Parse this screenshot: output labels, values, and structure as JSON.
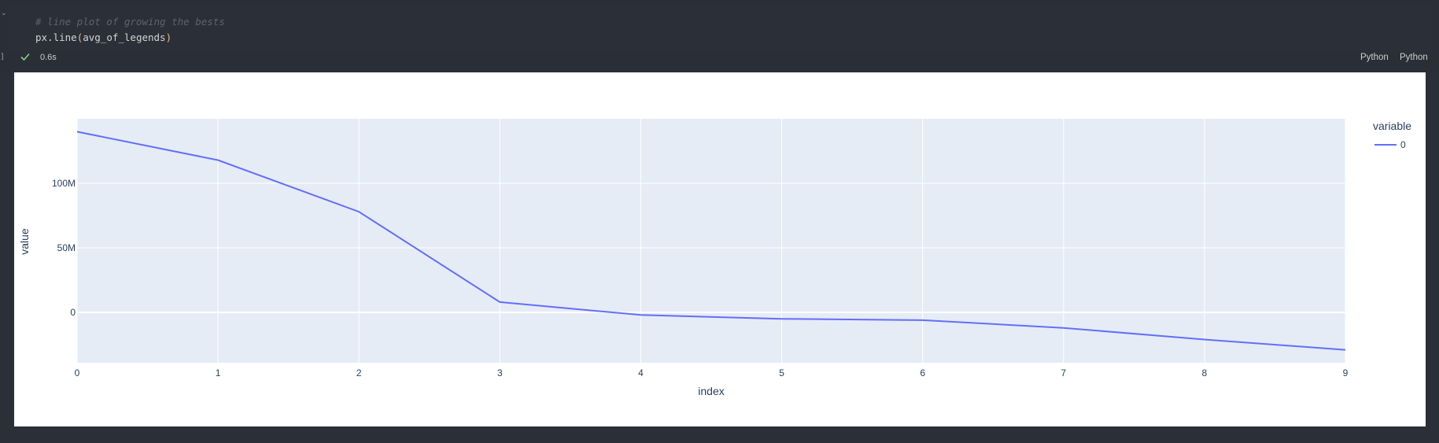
{
  "cell": {
    "code_comment": "# line plot of growing the bests",
    "code_fn": "px.line",
    "code_open": "(",
    "code_arg": "avg_of_legends",
    "code_close": ")",
    "exec_time": "0.6s",
    "lang_labels": [
      "Python",
      "Python"
    ]
  },
  "chart_data": {
    "type": "line",
    "title": "",
    "xlabel": "index",
    "ylabel": "value",
    "x": [
      0,
      1,
      2,
      3,
      4,
      5,
      6,
      7,
      8,
      9
    ],
    "x_ticks": [
      "0",
      "1",
      "2",
      "3",
      "4",
      "5",
      "6",
      "7",
      "8",
      "9"
    ],
    "y_ticks": [
      {
        "value": 0,
        "label": "0"
      },
      {
        "value": 50000000,
        "label": "50M"
      },
      {
        "value": 100000000,
        "label": "100M"
      }
    ],
    "xlim": [
      0,
      9
    ],
    "ylim": [
      -39000000,
      150000000
    ],
    "legend_title": "variable",
    "legend_placement": "top-right",
    "grid": true,
    "series": [
      {
        "name": "0",
        "color": "#636efa",
        "values": [
          140000000,
          118000000,
          78000000,
          8000000,
          -2000000,
          -5000000,
          -6000000,
          -12000000,
          -21000000,
          -29000000
        ]
      }
    ],
    "plot_bg": "#e5ecf6"
  }
}
